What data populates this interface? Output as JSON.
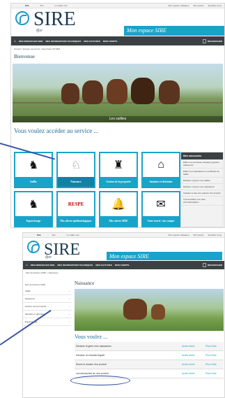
{
  "top": {
    "topbar": [
      "Sire",
      "Ifce",
      "Le Cadre noir"
    ],
    "topbar_right": [
      "Mon espace utilisateur",
      "Mon panier",
      "Identifiez-vous"
    ],
    "brand": "SIRE",
    "ifce": "ifce",
    "espace": "Mon espace SIRE",
    "nav": [
      "MES DÉMARCHES SIRE",
      "MES INFORMATIONS TECHNIQUES",
      "MES FACTURES",
      "MON COMPTE"
    ],
    "search_label": "RECHERCHER",
    "crumb": "Accueil > Espace personnel > Equi Faire SITHER",
    "title": "Bienvenue",
    "banner_caption": "Les saillies",
    "services_title": "Vous voulez accéder au service ...",
    "tiles": [
      {
        "label": "Saillie",
        "icon": "♞"
      },
      {
        "label": "Naissance",
        "icon": "♘"
      },
      {
        "label": "Gestion de la propriété",
        "icon": "♜"
      },
      {
        "label": "Sanitaire et détention",
        "icon": "⌂"
      },
      {
        "label": "Equarrissage",
        "icon": "♞"
      },
      {
        "label": "Mes alertes épidémiologiques",
        "icon": "RESPE"
      },
      {
        "label": "Mes alertes SIRE",
        "icon": "🔔"
      },
      {
        "label": "Votre écurie / son compte",
        "icon": "✉"
      }
    ],
    "side_title": "Mes raccourcis",
    "side_items": [
      "Editer une demande d'analyse (gestion traitement)",
      "Editer mes attestations et certificats de saillie",
      "Déclarer et gérer mes saillies",
      "Déclarer et gérer mes naissances",
      "Calculer le taux des papiers d'un produit",
      "Trouver/éditer une carte d'immatriculation"
    ]
  },
  "bottom": {
    "topbar": [
      "Sire",
      "Ifce",
      "Le Cadre noir"
    ],
    "topbar_right": [
      "Mon espace utilisateur",
      "Mon panier",
      "Identifiez-vous"
    ],
    "brand": "SIRE",
    "ifce": "ifce",
    "espace": "Mon espace SIRE",
    "nav": [
      "MES DÉMARCHES SIRE",
      "MES INFORMATIONS TECHNIQUES",
      "MES FACTURES",
      "MON COMPTE"
    ],
    "crumb": "Mes démarches SIRE > Naissance",
    "side_header": "Mes démarches SIRE",
    "side_items": [
      "Saillie",
      "Naissance",
      "Gestion de la propriété",
      "Sanitaire et détention",
      "Equarrissage"
    ],
    "title": "Naissance",
    "vv": "Vous voulez ...",
    "rows": [
      {
        "text": "Déclarer et gérer mes naissances",
        "a": "Accès direct",
        "b": "Plus d'info"
      },
      {
        "text": "Déclarer un résultat négatif",
        "a": "Accès direct",
        "b": "Plus d'info"
      },
      {
        "text": "Suivre le dossier d'un produit",
        "a": "Accès direct",
        "b": "Plus d'info"
      },
      {
        "text": "Les démarches de mon produit",
        "a": "Accès direct",
        "b": "Plus d'info"
      }
    ]
  },
  "colors": {
    "accent": "#1aa3c9",
    "nav": "#3b4142",
    "annotation": "#3a55a8"
  }
}
